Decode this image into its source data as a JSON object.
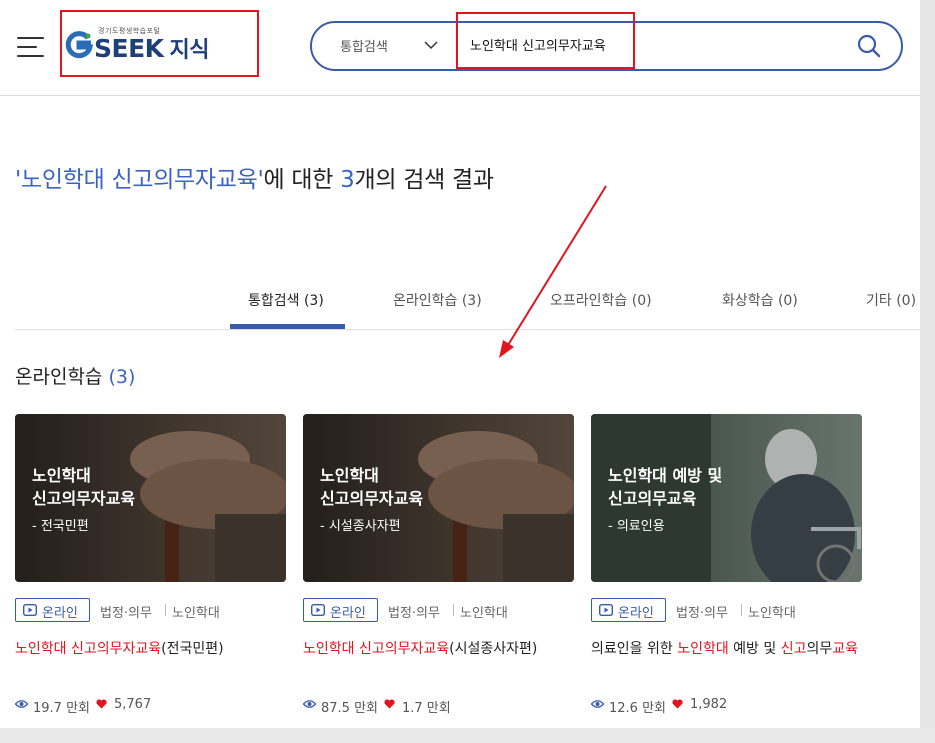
{
  "header": {
    "logo_tagline": "경기도평생학습포털",
    "logo_main": "SEEK",
    "logo_sub": "지식",
    "search_scope": "통합검색",
    "search_query": "노인학대 신고의무자교육"
  },
  "result": {
    "quote_open": "'",
    "query": "노인학대 신고의무자교육",
    "quote_close": "'",
    "mid": "에 대한 ",
    "count": "3",
    "suffix": "개의 검색 결과"
  },
  "tabs": [
    {
      "label": "통합검색 (3)",
      "active": true
    },
    {
      "label": "온라인학습 (3)",
      "active": false
    },
    {
      "label": "오프라인학습 (0)",
      "active": false
    },
    {
      "label": "화상학습 (0)",
      "active": false
    },
    {
      "label": "기타 (0)",
      "active": false
    }
  ],
  "section": {
    "title": "온라인학습",
    "count_open": "(",
    "count": "3",
    "count_close": ")"
  },
  "cards": [
    {
      "thumb_line1": "노인학대",
      "thumb_line2": "신고의무자교육",
      "thumb_sub": "- 전국민편",
      "badge": "온라인",
      "category1": "법정·의무",
      "category2": "노인학대",
      "title_hl1": "노인학대 신고의무자교육",
      "title_rest": "(전국민편)",
      "views": "19.7 만회",
      "likes": "5,767"
    },
    {
      "thumb_line1": "노인학대",
      "thumb_line2": "신고의무자교육",
      "thumb_sub": "- 시설종사자편",
      "badge": "온라인",
      "category1": "법정·의무",
      "category2": "노인학대",
      "title_hl1": "노인학대 신고의무자교육",
      "title_rest": "(시설종사자편)",
      "views": "87.5 만회",
      "likes": "1.7 만회"
    },
    {
      "thumb_line1": "노인학대 예방 및",
      "thumb_line2": "신고의무교육",
      "thumb_sub": "- 의료인용",
      "badge": "온라인",
      "category1": "법정·의무",
      "category2": "노인학대",
      "title_p1": "의료인을 위한 ",
      "title_hl1": "노인학대",
      "title_p2": " 예방 및 ",
      "title_hl2": "신고",
      "title_p3": "의무",
      "title_hl3": "교육",
      "views": "12.6 만회",
      "likes": "1,982"
    }
  ],
  "colors": {
    "accent": "#3a5ba8",
    "highlight": "#e0151e",
    "annotation": "#e0151e"
  }
}
